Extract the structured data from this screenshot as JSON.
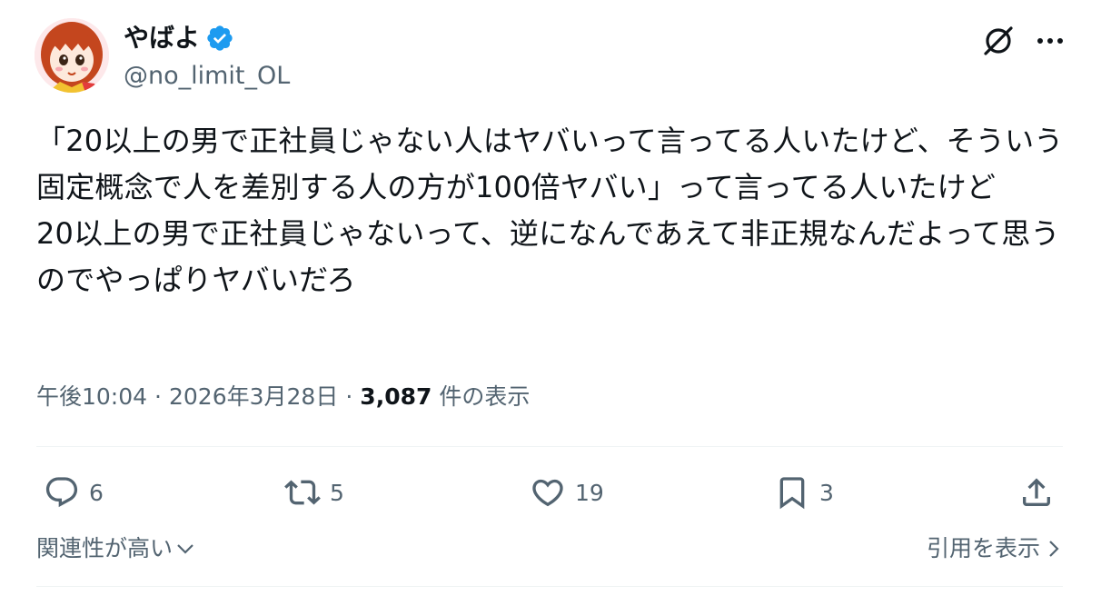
{
  "author": {
    "display_name": "やばよ",
    "handle": "@no_limit_OL",
    "verified": true
  },
  "tweet": {
    "text": "「20以上の男で正社員じゃない人はヤバいって言ってる人いたけど、そういう固定概念で人を差別する人の方が100倍ヤバい」って言ってる人いたけど\n20以上の男で正社員じゃないって、逆になんであえて非正規なんだよって思うのでやっぱりヤバいだろ"
  },
  "meta": {
    "time": "午後10:04",
    "separator": "·",
    "date": "2026年3月28日",
    "views_count": "3,087",
    "views_label": "件の表示"
  },
  "actions": {
    "replies": "6",
    "retweets": "5",
    "likes": "19",
    "bookmarks": "3"
  },
  "footer": {
    "relevance_label": "関連性が高い",
    "quotes_label": "引用を表示"
  },
  "icons": {
    "grok": "grok-icon",
    "more": "more-icon",
    "reply": "reply-icon",
    "retweet": "retweet-icon",
    "like": "heart-icon",
    "bookmark": "bookmark-icon",
    "share": "share-icon",
    "verified": "verified-badge-icon"
  },
  "colors": {
    "text": "#0f1419",
    "secondary": "#536471",
    "verified": "#1d9bf0",
    "divider": "#eff3f4"
  }
}
